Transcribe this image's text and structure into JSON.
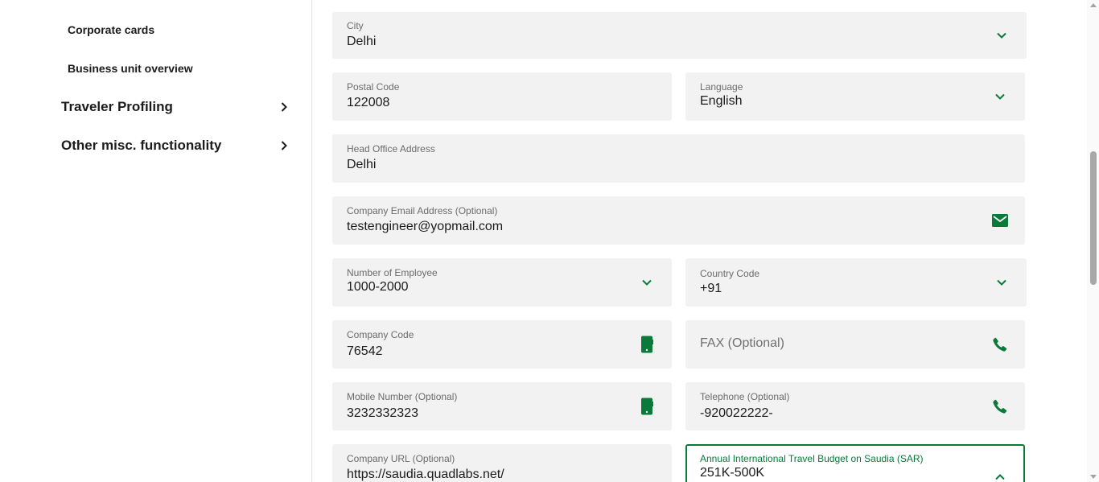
{
  "sidebar": {
    "sub_items": [
      "Corporate cards",
      "Business unit overview"
    ],
    "nav_items": [
      "Traveler Profiling",
      "Other misc. functionality"
    ]
  },
  "form": {
    "city": {
      "label": "City",
      "value": "Delhi",
      "icon": "chevron-down-icon"
    },
    "postal_code": {
      "label": "Postal Code",
      "value": "122008"
    },
    "language": {
      "label": "Language",
      "value": "English",
      "icon": "chevron-down-icon"
    },
    "head_office_address": {
      "label": "Head Office Address",
      "value": "Delhi"
    },
    "company_email": {
      "label": "Company Email Address (Optional)",
      "value": "testengineer@yopmail.com",
      "icon": "mail-icon"
    },
    "number_of_employee": {
      "label": "Number of Employee",
      "value": "1000-2000",
      "icon": "chevron-down-icon"
    },
    "country_code": {
      "label": "Country Code",
      "value": "+91",
      "icon": "chevron-down-icon"
    },
    "company_code": {
      "label": "Company Code",
      "value": "76542",
      "icon": "mobile-phone-icon"
    },
    "fax": {
      "placeholder": "FAX (Optional)",
      "icon": "phone-icon"
    },
    "mobile_number": {
      "label": "Mobile Number (Optional)",
      "value": "3232332323",
      "icon": "mobile-phone-icon"
    },
    "telephone": {
      "label": "Telephone (Optional)",
      "value": "-920022222-",
      "icon": "phone-icon"
    },
    "company_url": {
      "label": "Company URL (Optional)",
      "value": "https://saudia.quadlabs.net/"
    },
    "annual_budget": {
      "label": "Annual International Travel Budget on Saudia (SAR)",
      "value": "251K-500K",
      "icon": "chevron-up-icon"
    }
  },
  "colors": {
    "accent": "#0a7a3b",
    "field_bg": "#f2f2f2",
    "text": "#1b1b1b",
    "label": "#6b6b6b"
  }
}
